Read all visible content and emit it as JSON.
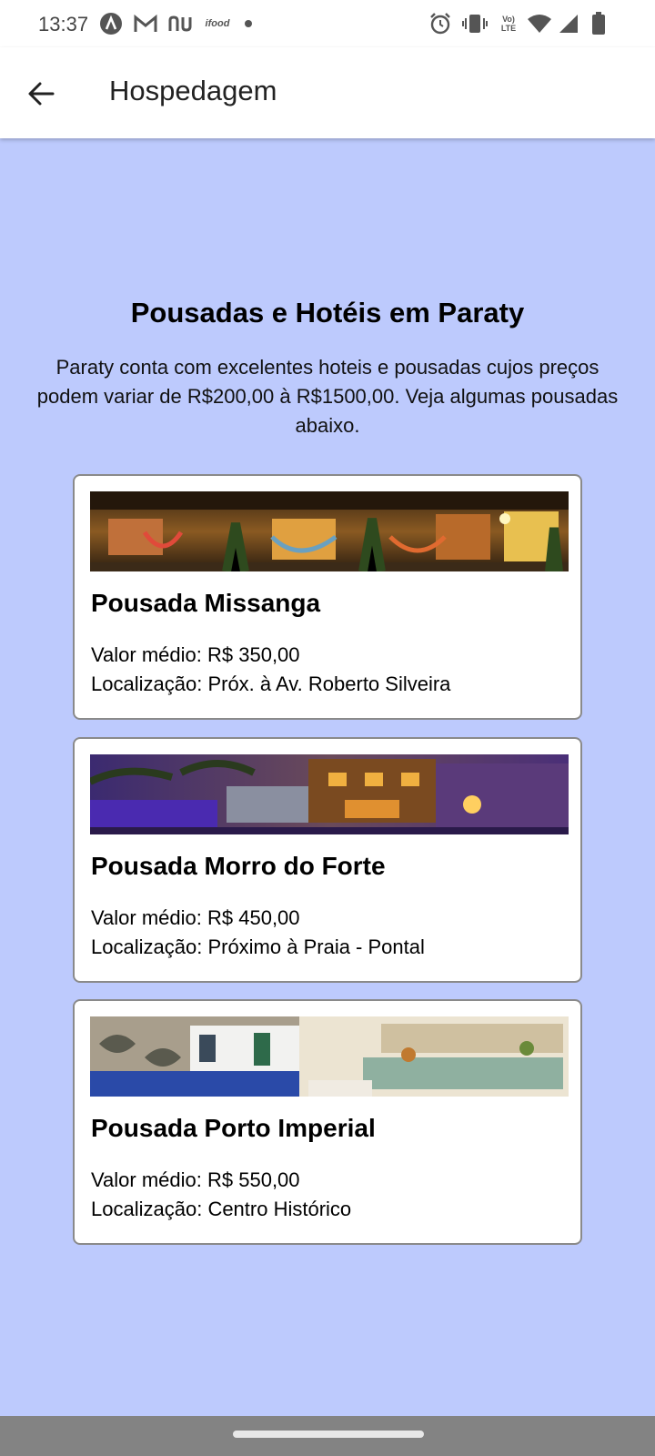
{
  "status_bar": {
    "time": "13:37",
    "left_icons": [
      "circle-a-icon",
      "gmail-icon",
      "nubank-icon",
      "ifood-icon",
      "dot-icon"
    ],
    "ifood_label": "ifood",
    "lte_label_top": "Vo)",
    "lte_label_bottom": "LTE",
    "right_icons": [
      "alarm-icon",
      "vibrate-icon",
      "volte-icon",
      "wifi-icon",
      "signal-icon",
      "battery-icon"
    ]
  },
  "app_bar": {
    "back_icon": "arrow-left-icon",
    "title": "Hospedagem"
  },
  "main": {
    "heading": "Pousadas e Hotéis em Paraty",
    "intro": "Paraty conta com excelentes hoteis e pousadas cujos preços podem variar de R$200,00 à R$1500,00. Veja algumas pousadas abaixo."
  },
  "cards": [
    {
      "name": "Pousada Missanga",
      "price_label": "Valor médio:",
      "price": "R$ 350,00",
      "location_label": "Localização:",
      "location": "Próx. à Av. Roberto Silveira"
    },
    {
      "name": "Pousada Morro do Forte",
      "price_label": "Valor médio:",
      "price": "R$ 450,00",
      "location_label": "Localização:",
      "location": "Próximo à Praia - Pontal"
    },
    {
      "name": "Pousada Porto Imperial",
      "price_label": "Valor médio:",
      "price": "R$ 550,00",
      "location_label": "Localização:",
      "location": "Centro Histórico"
    }
  ],
  "colors": {
    "page_background": "#bdcafd",
    "card_border": "#8a8a8a",
    "nav_bar": "#838383"
  }
}
